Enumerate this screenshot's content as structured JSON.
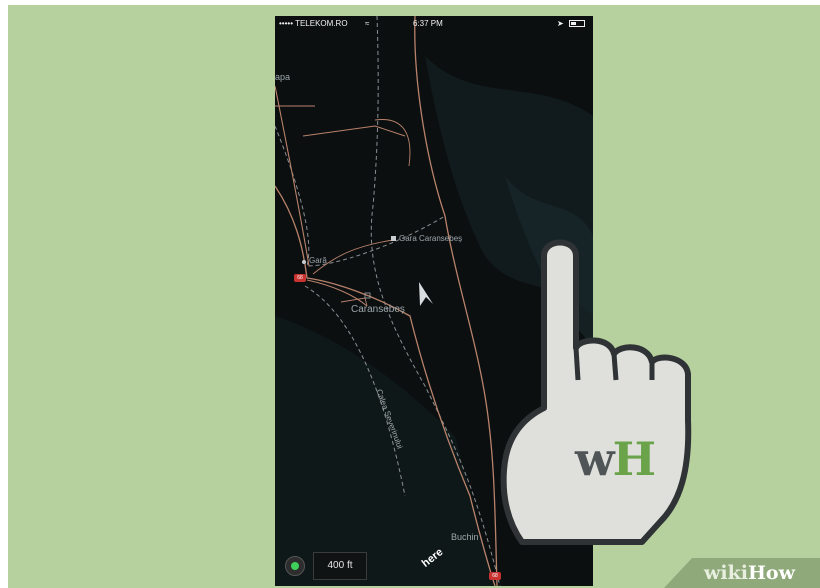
{
  "status_bar": {
    "carrier": "••••• TELEKOM.RO",
    "wifi_icon": "wifi-icon",
    "time": "6:37 PM",
    "location_icon": "location-arrow-icon",
    "battery_icon": "battery-icon"
  },
  "map": {
    "labels": {
      "gara_caransebes": "Gara Caransebeș",
      "gara": "Gară",
      "caransebes": "Caransebeș",
      "calea_severinului": "Calea Severinului",
      "buchin": "Buchin",
      "apa": "apa"
    },
    "route_number": "68",
    "position_icon": "navigation-arrow-icon"
  },
  "bottom_bar": {
    "scale": "400 ft",
    "provider_logo": "here"
  },
  "logo": {
    "w": "w",
    "h": "H"
  },
  "watermark": {
    "wiki": "wiki",
    "how": "How"
  },
  "colors": {
    "background": "#b6d19e",
    "map_background": "#0b0f10",
    "road": "#b9826b",
    "rail": "#8a8f93",
    "location_green": "#3ecf5a",
    "wh_dark": "#4f5557",
    "wh_green": "#6aa34a"
  }
}
